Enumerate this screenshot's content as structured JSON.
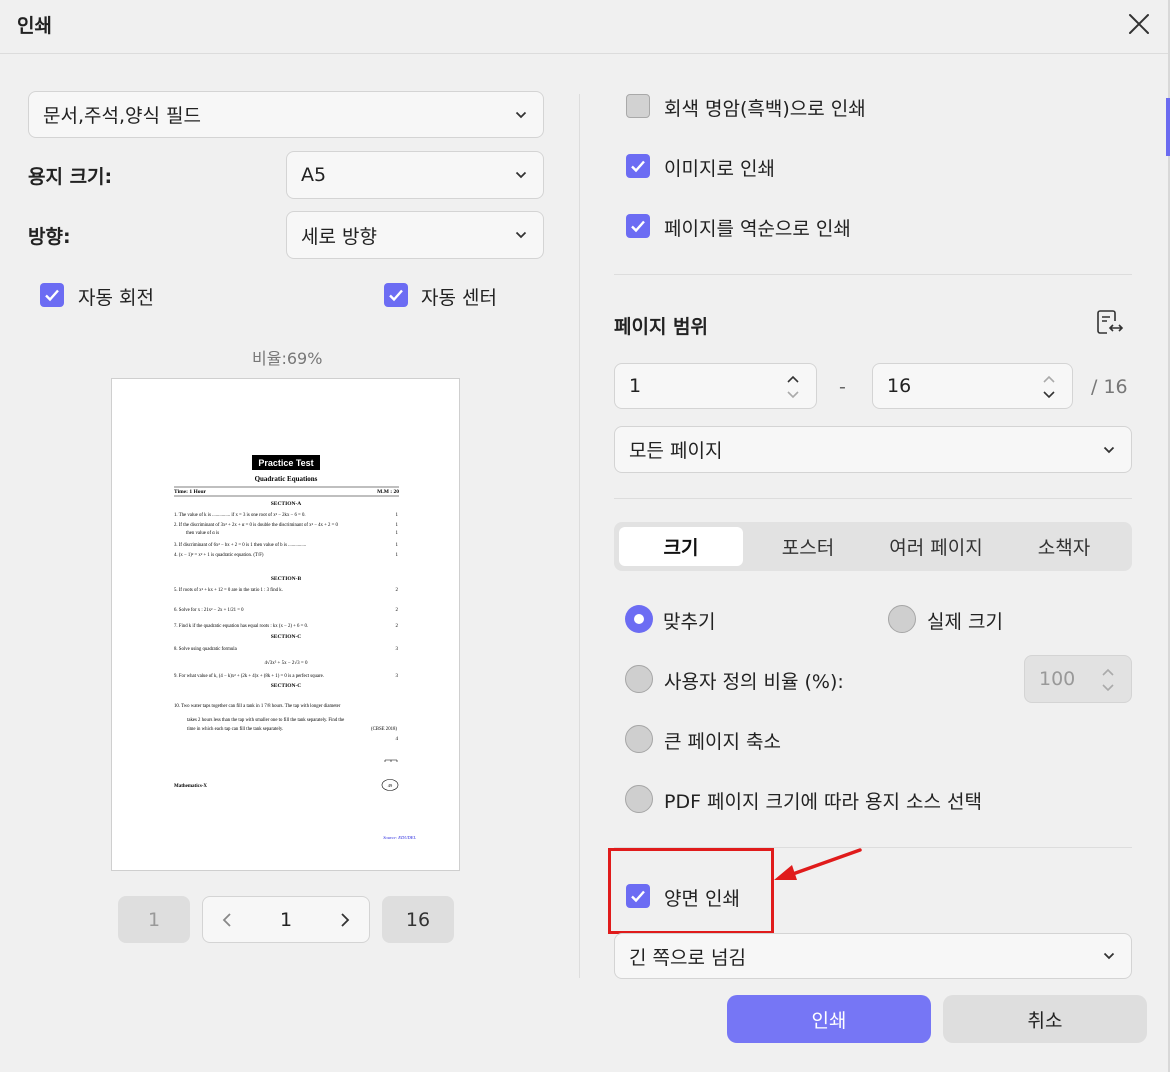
{
  "title": "인쇄",
  "left": {
    "content_select": "문서,주석,양식 필드",
    "paper_size_label": "용지 크기:",
    "paper_size_value": "A5",
    "orientation_label": "방향:",
    "orientation_value": "세로 방향",
    "auto_rotate": "자동 회전",
    "auto_center": "자동 센터",
    "scale_text": "비율:69%",
    "pager": {
      "first": "1",
      "current": "1",
      "last": "16"
    }
  },
  "preview_doc": {
    "heading": "Practice Test",
    "subheading": "Quadratic Equations",
    "time": "Time: 1 Hour",
    "marks": "M.M : 20",
    "sec_a": "SECTION-A",
    "q1": "1.  The value of k is ............... if x = 3 is one root of x² − 2kx − 6 = 0.",
    "q2": "2.  If the discriminant of 3x² + 2x + α = 0 is double the discriminant of x² − 4x + 2 = 0",
    "q2b": "then value of α is",
    "q3": "3.  If discriminant of 6x² − bx + 2 = 0 is 1 then value of b is ...............",
    "q4": "4.  (x − 1)² = x² + 1 is quadratic equation. (T/F)",
    "sec_b": "SECTION-B",
    "q5": "5.  If roots of x² + kx + 12 = 0 are in the ratio 1 : 3 find k.",
    "q6": "6.  Solve for x : 21x² − 2x + 1/21 = 0",
    "q7": "7.  Find k if the quadratic equation has equal roots : kx (x − 2) + 6 = 0.",
    "sec_c": "SECTION-C",
    "q8": "8.  Solve using quadratic formula",
    "q8b": "4√3x² + 5x − 2√3 = 0",
    "q9": "9.  For what value of k, (4 − k)x² + (2k + 4)x + (8k + 1) = 0 is a perfect square.",
    "sec_c2": "SECTION-C",
    "q10": "10. Two water taps together can fill a tank in 1 7/8 hours. The tap with longer diameter",
    "q10b": "takes 2 hours less than the tap with smaller one to fill the tank separately. Find the",
    "q10c": "time in which each tap can fill the tank separately.",
    "q10d": "(CBSE 2018)",
    "m1": "1",
    "m2": "1",
    "m2b": "1",
    "m3": "1",
    "m4": "1",
    "m5": "2",
    "m6": "2",
    "m7": "2",
    "m8": "3",
    "m9": "3",
    "m10": "4",
    "footer": "Mathematics-X",
    "page_no": "49",
    "source": "Source: EDUDEL"
  },
  "right": {
    "grayscale": "회색 명암(흑백)으로 인쇄",
    "as_image": "이미지로 인쇄",
    "reverse": "페이지를 역순으로 인쇄",
    "range_title": "페이지 범위",
    "range_from": "1",
    "range_dash": "-",
    "range_to": "16",
    "range_total": "/ 16",
    "range_select": "모든 페이지",
    "tabs": [
      "크기",
      "포스터",
      "여러 페이지",
      "소책자"
    ],
    "fit": "맞추기",
    "actual_size": "실제 크기",
    "custom_scale": "사용자 정의 비율 (%):",
    "custom_scale_value": "100",
    "shrink": "큰 페이지 축소",
    "pdf_source": "PDF 페이지 크기에 따라 용지 소스 선택",
    "duplex": "양면 인쇄",
    "duplex_select": "긴 쪽으로 넘김"
  },
  "buttons": {
    "print": "인쇄",
    "cancel": "취소"
  },
  "colors": {
    "accent": "#6c6cf3",
    "annotation": "#e01b1b",
    "primary_button": "#7676f5"
  }
}
